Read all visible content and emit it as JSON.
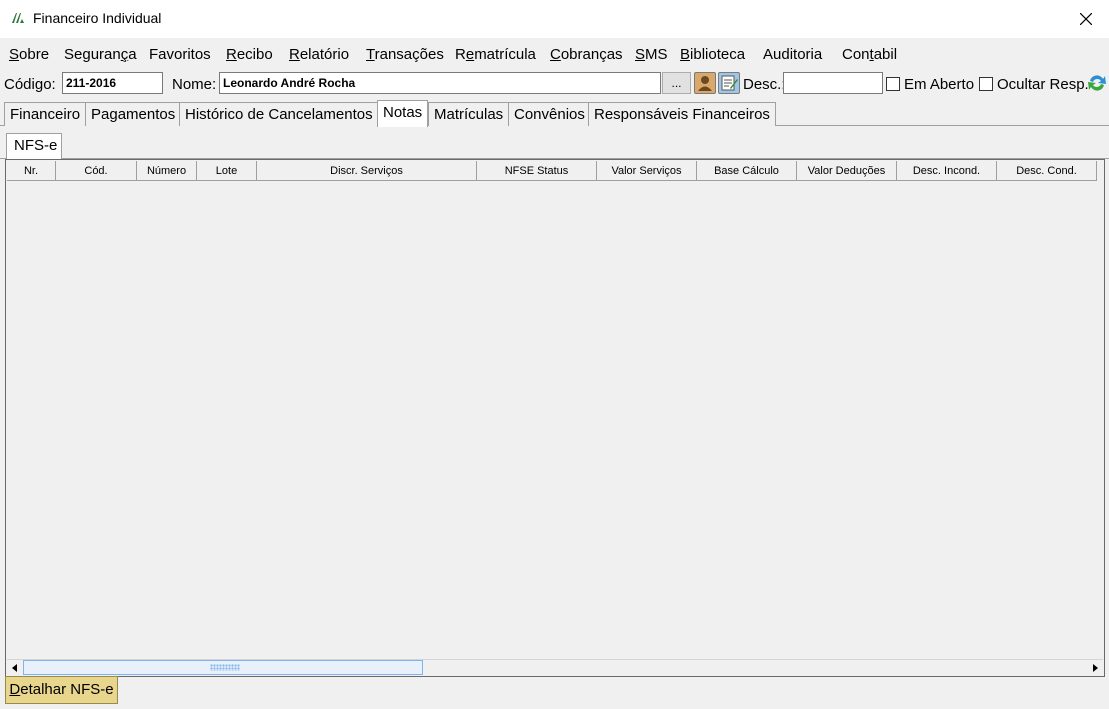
{
  "window": {
    "title": "Financeiro Individual",
    "icon": "app-logo-icon",
    "close": "close-icon"
  },
  "menu": [
    {
      "pre": "",
      "u": "S",
      "post": "obre"
    },
    {
      "pre": "Seguran",
      "u": "ç",
      "post": "a"
    },
    {
      "pre": "Favoritos",
      "u": "",
      "post": ""
    },
    {
      "pre": "",
      "u": "R",
      "post": "ecibo"
    },
    {
      "pre": "",
      "u": "R",
      "post": "elatório"
    },
    {
      "pre": "",
      "u": "T",
      "post": "ransações"
    },
    {
      "pre": "R",
      "u": "e",
      "post": "matrícula"
    },
    {
      "pre": "",
      "u": "C",
      "post": "obranças"
    },
    {
      "pre": "",
      "u": "S",
      "post": "MS"
    },
    {
      "pre": "",
      "u": "B",
      "post": "iblioteca"
    },
    {
      "pre": "Auditoria",
      "u": "",
      "post": ""
    },
    {
      "pre": "Con",
      "u": "t",
      "post": "abil"
    }
  ],
  "toolbar": {
    "codigo_label": "Código:",
    "codigo_value": "211-2016",
    "nome_label": "Nome:",
    "nome_value": "Leonardo André Rocha",
    "ellipsis_button": "...",
    "desc_label": "Desc.:",
    "desc_value": "",
    "em_aberto_label": "Em Aberto",
    "em_aberto_checked": false,
    "ocultar_resp_label": "Ocultar Resp.",
    "ocultar_resp_checked": false
  },
  "tabs": [
    "Financeiro",
    "Pagamentos",
    "Histórico de Cancelamentos",
    "Notas",
    "Matrículas",
    "Convênios",
    "Responsáveis Financeiros"
  ],
  "active_tab": "Notas",
  "subtab": "NFS-e",
  "grid": {
    "columns": [
      "Nr.",
      "Cód.",
      "Número",
      "Lote",
      "Discr. Serviços",
      "NFSE Status",
      "Valor Serviços",
      "Base Cálculo",
      "Valor Deduções",
      "Desc. Incond.",
      "Desc. Cond."
    ],
    "rows": []
  },
  "detail_button": {
    "u": "D",
    "rest": "etalhar NFS-e"
  },
  "colors": {
    "accent_button": "#e8d68c",
    "window_bg": "#f0f0f0",
    "thumb": "#e8f1fb"
  }
}
